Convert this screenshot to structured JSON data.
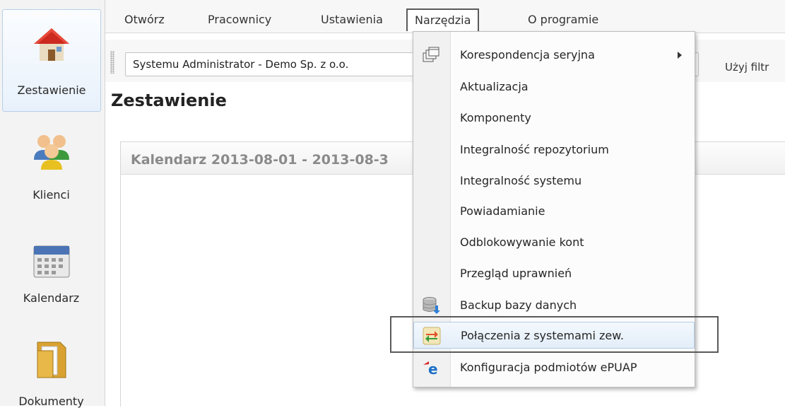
{
  "sidebar": {
    "items": [
      {
        "label": "Zestawienie",
        "icon": "home-icon"
      },
      {
        "label": "Klienci",
        "icon": "users-icon"
      },
      {
        "label": "Kalendarz",
        "icon": "calendar-icon"
      },
      {
        "label": "Dokumenty",
        "icon": "folder-icon"
      }
    ]
  },
  "menubar": {
    "items": [
      "Otwórz",
      "Pracownicy",
      "Ustawienia",
      "Narzędzia",
      "O programie"
    ]
  },
  "toolbar": {
    "combo_value": "Systemu Administrator - Demo Sp. z o.o.",
    "filter_label": "Użyj filtr"
  },
  "page": {
    "title": "Zestawienie",
    "panel_title": "Kalendarz  2013-08-01 - 2013-08-3"
  },
  "dropdown": {
    "items": [
      {
        "label": "Korespondencja seryjna",
        "icon": "windows-icon",
        "submenu": true
      },
      {
        "label": "Aktualizacja",
        "icon": ""
      },
      {
        "label": "Komponenty",
        "icon": ""
      },
      {
        "label": "Integralność repozytorium",
        "icon": ""
      },
      {
        "label": "Integralność systemu",
        "icon": ""
      },
      {
        "label": "Powiadamianie",
        "icon": ""
      },
      {
        "label": "Odblokowywanie kont",
        "icon": ""
      },
      {
        "label": "Przegląd uprawnień",
        "icon": ""
      },
      {
        "label": "Backup bazy danych",
        "icon": "database-icon"
      },
      {
        "label": "Połączenia z systemami zew.",
        "icon": "sync-arrows-icon",
        "hover": true
      },
      {
        "label": "Konfiguracja podmiotów ePUAP",
        "icon": "epuap-icon"
      }
    ]
  },
  "colors": {
    "accent_border": "#b3cce6",
    "highlight_frame": "#5a5a5a"
  }
}
